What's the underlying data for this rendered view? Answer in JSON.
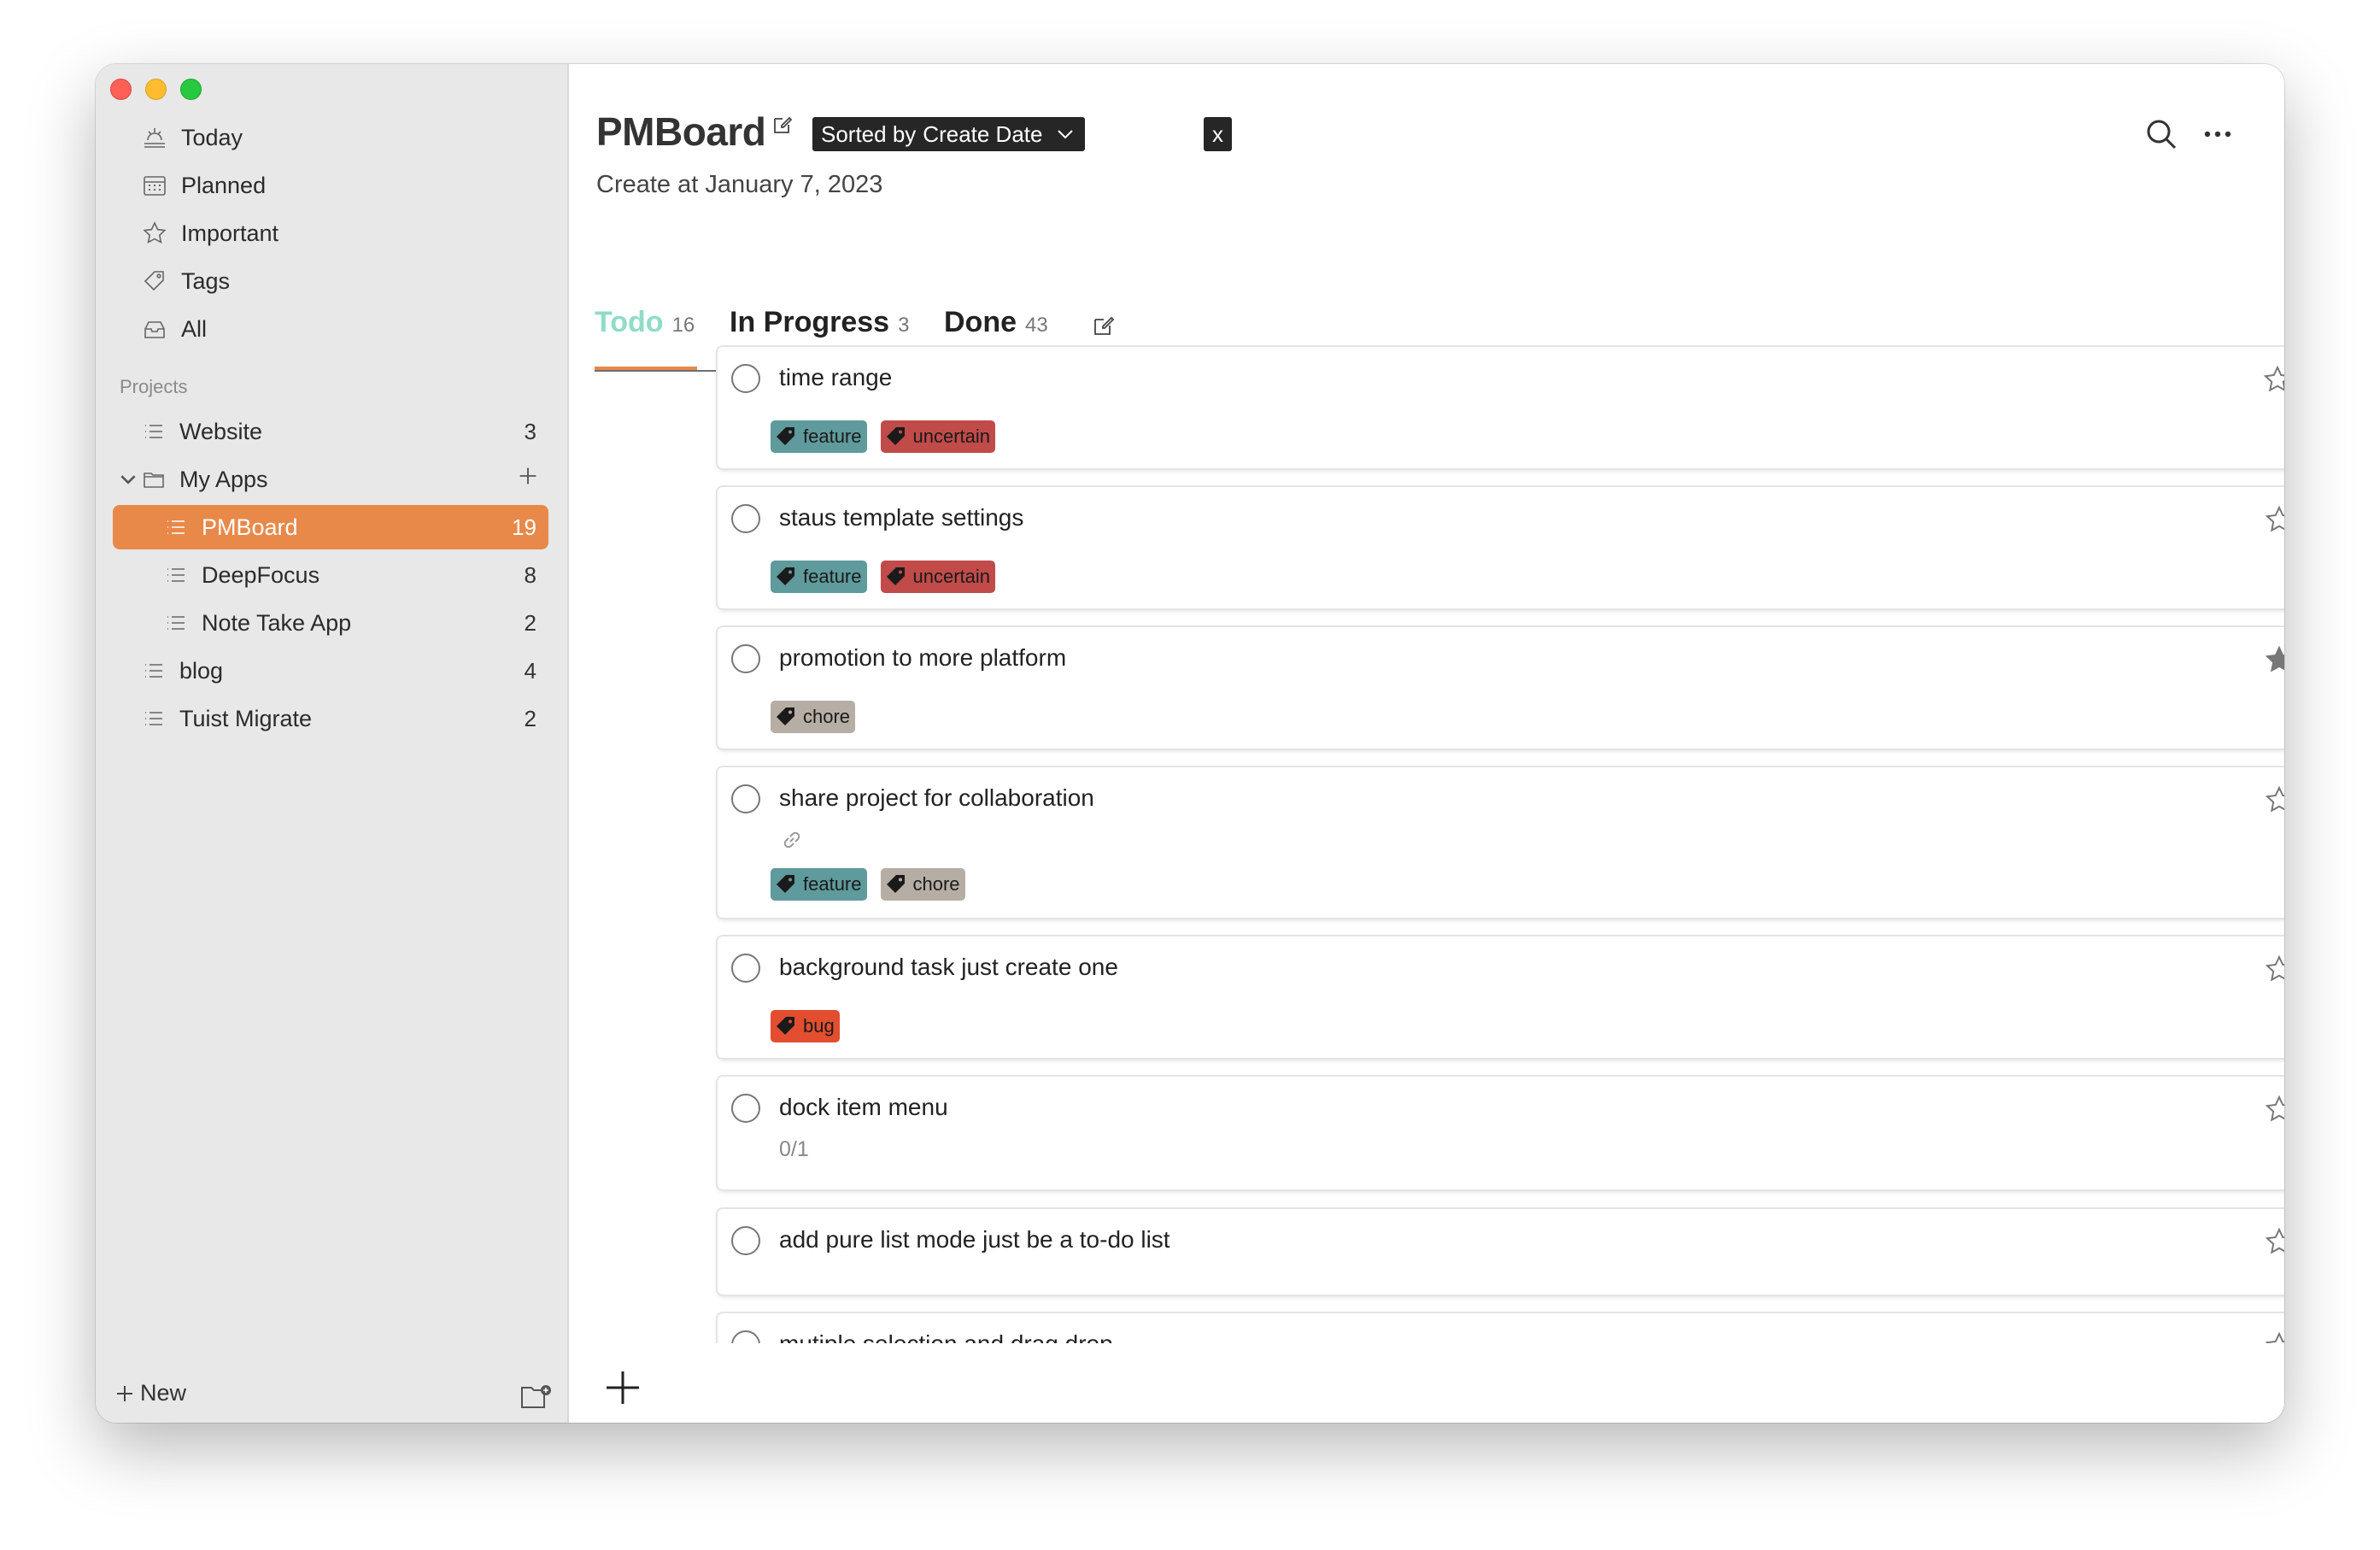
{
  "sidebar": {
    "nav": [
      {
        "label": "Today",
        "icon": "sunrise-icon"
      },
      {
        "label": "Planned",
        "icon": "calendar-icon"
      },
      {
        "label": "Important",
        "icon": "star-icon"
      },
      {
        "label": "Tags",
        "icon": "tag-icon"
      },
      {
        "label": "All",
        "icon": "tray-icon"
      }
    ],
    "projects_title": "Projects",
    "projects": [
      {
        "label": "Website",
        "count": "3"
      },
      {
        "label": "My Apps",
        "count": ""
      },
      {
        "label": "PMBoard",
        "count": "19"
      },
      {
        "label": "DeepFocus",
        "count": "8"
      },
      {
        "label": "Note Take App",
        "count": "2"
      },
      {
        "label": "blog",
        "count": "4"
      },
      {
        "label": "Tuist Migrate",
        "count": "2"
      }
    ],
    "new_label": "New"
  },
  "header": {
    "title": "PMBoard",
    "sort_prefix": "Sorted by",
    "sort_value": "Create Date",
    "sort_clear": "x",
    "subtitle": "Create at January 7, 2023"
  },
  "tabs": [
    {
      "label": "Todo",
      "count": "16"
    },
    {
      "label": "In Progress",
      "count": "3"
    },
    {
      "label": "Done",
      "count": "43"
    }
  ],
  "tasks": [
    {
      "title": "time range",
      "tags": [
        "feature",
        "uncertain"
      ],
      "starred": false
    },
    {
      "title": "staus template settings",
      "tags": [
        "feature",
        "uncertain"
      ],
      "starred": false
    },
    {
      "title": "promotion to more platform",
      "tags": [
        "chore"
      ],
      "starred": true
    },
    {
      "title": "share project for collaboration",
      "tags": [
        "feature",
        "chore"
      ],
      "starred": false
    },
    {
      "title": "background task just create one",
      "tags": [
        "bug"
      ],
      "starred": false
    },
    {
      "title": "dock item menu",
      "subtasks": "0/1",
      "starred": false
    },
    {
      "title": "add pure list mode just be a to-do list",
      "starred": false
    },
    {
      "title": "mutiple selection and drag drop",
      "starred": false
    }
  ],
  "colors": {
    "accent": "#e8894a",
    "active_tab": "#8fdcc8",
    "tag_feature": "#5f9a9c",
    "tag_uncertain": "#c04b49",
    "tag_chore": "#b6aea4",
    "tag_bug": "#e24e2f"
  }
}
